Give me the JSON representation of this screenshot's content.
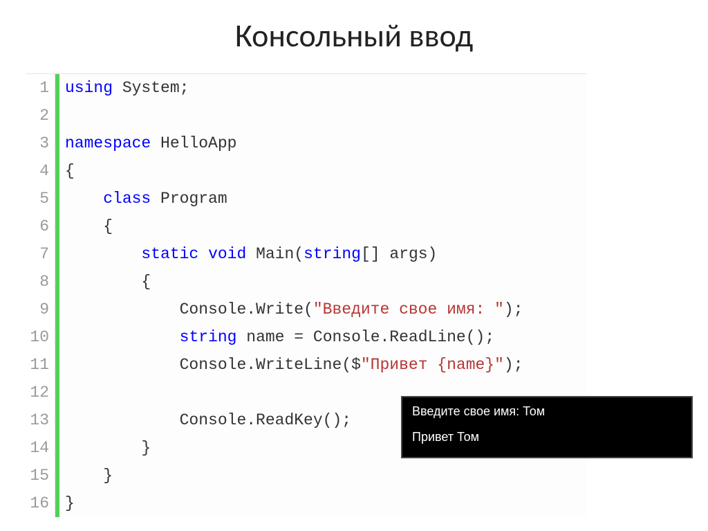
{
  "title": "Консольный ввод",
  "code": {
    "lineNumbers": [
      "1",
      "2",
      "3",
      "4",
      "5",
      "6",
      "7",
      "8",
      "9",
      "10",
      "11",
      "12",
      "13",
      "14",
      "15",
      "16"
    ],
    "lines": [
      [
        {
          "cls": "k",
          "t": "using"
        },
        {
          "cls": "p",
          "t": " System;"
        }
      ],
      [
        {
          "cls": "p",
          "t": ""
        }
      ],
      [
        {
          "cls": "k",
          "t": "namespace"
        },
        {
          "cls": "p",
          "t": " HelloApp"
        }
      ],
      [
        {
          "cls": "p",
          "t": "{"
        }
      ],
      [
        {
          "cls": "p",
          "t": "    "
        },
        {
          "cls": "k",
          "t": "class"
        },
        {
          "cls": "p",
          "t": " Program"
        }
      ],
      [
        {
          "cls": "p",
          "t": "    {"
        }
      ],
      [
        {
          "cls": "p",
          "t": "        "
        },
        {
          "cls": "k",
          "t": "static"
        },
        {
          "cls": "p",
          "t": " "
        },
        {
          "cls": "k",
          "t": "void"
        },
        {
          "cls": "p",
          "t": " Main("
        },
        {
          "cls": "k",
          "t": "string"
        },
        {
          "cls": "p",
          "t": "[] args)"
        }
      ],
      [
        {
          "cls": "p",
          "t": "        {"
        }
      ],
      [
        {
          "cls": "p",
          "t": "            Console.Write("
        },
        {
          "cls": "s",
          "t": "\"Введите свое имя: \""
        },
        {
          "cls": "p",
          "t": ");"
        }
      ],
      [
        {
          "cls": "p",
          "t": "            "
        },
        {
          "cls": "k",
          "t": "string"
        },
        {
          "cls": "p",
          "t": " name = Console.ReadLine();"
        }
      ],
      [
        {
          "cls": "p",
          "t": "            Console.WriteLine($"
        },
        {
          "cls": "s",
          "t": "\"Привет {name}\""
        },
        {
          "cls": "p",
          "t": ");"
        }
      ],
      [
        {
          "cls": "p",
          "t": ""
        }
      ],
      [
        {
          "cls": "p",
          "t": "            Console.ReadKey();"
        }
      ],
      [
        {
          "cls": "p",
          "t": "        }"
        }
      ],
      [
        {
          "cls": "p",
          "t": "    }"
        }
      ],
      [
        {
          "cls": "p",
          "t": "}"
        }
      ]
    ]
  },
  "console": {
    "line1": "Введите свое имя: Том",
    "line2": "Привет Том"
  }
}
